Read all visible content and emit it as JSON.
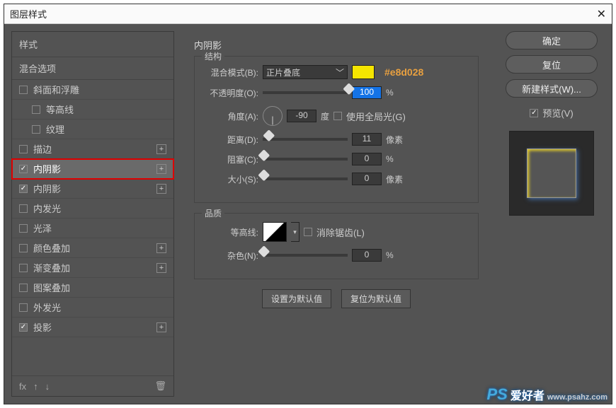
{
  "dialog": {
    "title": "图层样式",
    "close": "✕"
  },
  "left": {
    "header": "样式",
    "blend_options": "混合选项",
    "items": [
      {
        "label": "斜面和浮雕",
        "checked": false,
        "add": false
      },
      {
        "label": "等高线",
        "checked": false,
        "add": false,
        "indent": true
      },
      {
        "label": "纹理",
        "checked": false,
        "add": false,
        "indent": true
      },
      {
        "label": "描边",
        "checked": false,
        "add": true
      },
      {
        "label": "内阴影",
        "checked": true,
        "add": true,
        "selected": true,
        "redbox": true
      },
      {
        "label": "内阴影",
        "checked": true,
        "add": true
      },
      {
        "label": "内发光",
        "checked": false,
        "add": false
      },
      {
        "label": "光泽",
        "checked": false,
        "add": false
      },
      {
        "label": "颜色叠加",
        "checked": false,
        "add": true
      },
      {
        "label": "渐变叠加",
        "checked": false,
        "add": true
      },
      {
        "label": "图案叠加",
        "checked": false,
        "add": false
      },
      {
        "label": "外发光",
        "checked": false,
        "add": false
      },
      {
        "label": "投影",
        "checked": true,
        "add": true
      }
    ],
    "footer_fx": "fx",
    "footer_trash": "🗑"
  },
  "panel": {
    "title": "内阴影",
    "structure": {
      "title": "结构",
      "blend_mode_label": "混合模式(B):",
      "blend_mode_value": "正片叠底",
      "color_annot": "#e8d028",
      "opacity_label": "不透明度(O):",
      "opacity_value": "100",
      "opacity_unit": "%",
      "angle_label": "角度(A):",
      "angle_value": "-90",
      "angle_unit": "度",
      "global_light_label": "使用全局光(G)",
      "distance_label": "距离(D):",
      "distance_value": "11",
      "distance_unit": "像素",
      "choke_label": "阻塞(C):",
      "choke_value": "0",
      "choke_unit": "%",
      "size_label": "大小(S):",
      "size_value": "0",
      "size_unit": "像素"
    },
    "quality": {
      "title": "品质",
      "contour_label": "等高线:",
      "antialias_label": "消除锯齿(L)",
      "noise_label": "杂色(N):",
      "noise_value": "0",
      "noise_unit": "%"
    },
    "btn_default": "设置为默认值",
    "btn_reset": "复位为默认值"
  },
  "right": {
    "ok": "确定",
    "cancel": "复位",
    "new_style": "新建样式(W)...",
    "preview": "预览(V)"
  },
  "watermark": {
    "ps": "PS",
    "text": "爱好者",
    "url": "www.psahz.com"
  }
}
